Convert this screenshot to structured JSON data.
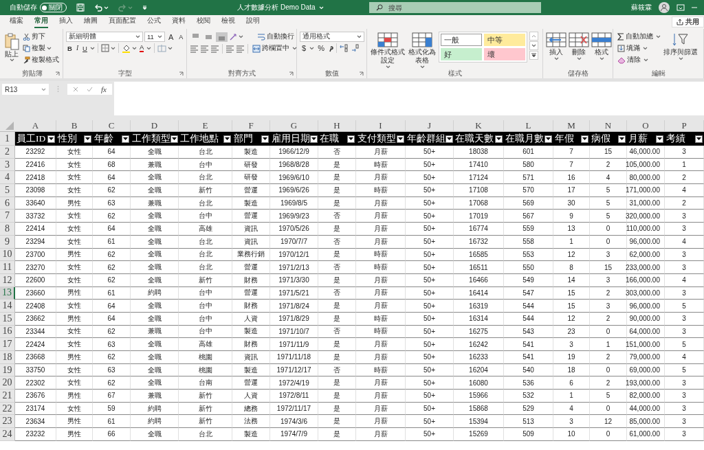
{
  "title_bar": {
    "autosave_label": "自動儲存",
    "autosave_toggle": {
      "label": "關閉",
      "on": false
    },
    "document_title": "人才數據分析 Demo Data",
    "search": {
      "placeholder": "搜尋"
    },
    "user_name": "蘇筱霖"
  },
  "ribbon_tabs": [
    {
      "label": "檔案",
      "selected": false
    },
    {
      "label": "常用",
      "selected": true
    },
    {
      "label": "插入",
      "selected": false
    },
    {
      "label": "繪圖",
      "selected": false
    },
    {
      "label": "頁面配置",
      "selected": false
    },
    {
      "label": "公式",
      "selected": false
    },
    {
      "label": "資料",
      "selected": false
    },
    {
      "label": "校閱",
      "selected": false
    },
    {
      "label": "檢視",
      "selected": false
    },
    {
      "label": "說明",
      "selected": false
    }
  ],
  "share_button": "共用",
  "clipboard": {
    "title": "剪貼簿",
    "paste": "貼上",
    "cut": "剪下",
    "copy": "複製",
    "format_painter": "複製格式"
  },
  "font": {
    "title": "字型",
    "font_name": "新細明體",
    "font_size": "11",
    "grow": "A",
    "shrink": "A",
    "bold": "B",
    "italic": "I",
    "underline": "U",
    "font_color": "A"
  },
  "alignment": {
    "title": "對齊方式",
    "vertical_align": [
      {
        "selected": false
      },
      {
        "selected": false
      },
      {
        "selected": true
      }
    ],
    "wrap_text": "自動換行",
    "merge_center": "跨欄置中"
  },
  "number": {
    "title": "數值",
    "format": "通用格式",
    "currency": "$",
    "percent": "%"
  },
  "styles": {
    "title": "樣式",
    "conditional_formatting": "條件式格式設定",
    "format_as_table": "格式化為表格",
    "cell_styles": [
      {
        "label": "一般",
        "color": "#ffffff"
      },
      {
        "label": "中等",
        "color": "#ffeb9c"
      },
      {
        "label": "好",
        "color": "#c6efce"
      },
      {
        "label": "壞",
        "color": "#ffc7ce"
      }
    ]
  },
  "cells": {
    "title": "儲存格",
    "insert": "插入",
    "delete": "刪除",
    "format": "格式"
  },
  "editing": {
    "title": "編輯",
    "autosum": "自動加總",
    "fill": "填滿",
    "clear": "清除",
    "sort_filter": "排序與篩選"
  },
  "formula_bar": {
    "name_box": "R13",
    "function_button": "fx"
  },
  "sheet": {
    "columns": [
      {
        "letter": "A",
        "header": "員工ID"
      },
      {
        "letter": "B",
        "header": "性別"
      },
      {
        "letter": "C",
        "header": "年齡"
      },
      {
        "letter": "D",
        "header": "工作類型"
      },
      {
        "letter": "E",
        "header": "工作地點"
      },
      {
        "letter": "F",
        "header": "部門"
      },
      {
        "letter": "G",
        "header": "雇用日期"
      },
      {
        "letter": "H",
        "header": "在職"
      },
      {
        "letter": "I",
        "header": "支付類型"
      },
      {
        "letter": "J",
        "header": "年齡群組"
      },
      {
        "letter": "K",
        "header": "在職天數"
      },
      {
        "letter": "L",
        "header": "在職月數"
      },
      {
        "letter": "M",
        "header": "年假"
      },
      {
        "letter": "N",
        "header": "病假"
      },
      {
        "letter": "O",
        "header": "月薪"
      },
      {
        "letter": "P",
        "header": "考績"
      }
    ],
    "header_row_number": "1",
    "rows": [
      {
        "number": "2",
        "selected": false,
        "cells": [
          "23292",
          "女性",
          "64",
          "全職",
          "台北",
          "製造",
          "1966/12/9",
          "否",
          "月薪",
          "50+",
          "18038",
          "601",
          "7",
          "15",
          "46,000.00",
          "3"
        ]
      },
      {
        "number": "3",
        "selected": false,
        "cells": [
          "22416",
          "女性",
          "68",
          "兼職",
          "台中",
          "研發",
          "1968/8/28",
          "是",
          "時薪",
          "50+",
          "17410",
          "580",
          "7",
          "2",
          "105,000.00",
          "1"
        ]
      },
      {
        "number": "4",
        "selected": false,
        "cells": [
          "22418",
          "女性",
          "64",
          "全職",
          "台北",
          "研發",
          "1969/6/10",
          "是",
          "月薪",
          "50+",
          "17124",
          "571",
          "16",
          "4",
          "80,000.00",
          "2"
        ]
      },
      {
        "number": "5",
        "selected": false,
        "cells": [
          "23098",
          "女性",
          "62",
          "全職",
          "新竹",
          "營運",
          "1969/6/26",
          "是",
          "時薪",
          "50+",
          "17108",
          "570",
          "17",
          "5",
          "171,000.00",
          "4"
        ]
      },
      {
        "number": "6",
        "selected": false,
        "cells": [
          "33640",
          "男性",
          "63",
          "兼職",
          "台北",
          "製造",
          "1969/8/5",
          "是",
          "月薪",
          "50+",
          "17068",
          "569",
          "30",
          "5",
          "31,000.00",
          "2"
        ]
      },
      {
        "number": "7",
        "selected": false,
        "cells": [
          "33732",
          "女性",
          "62",
          "全職",
          "台中",
          "營運",
          "1969/9/23",
          "否",
          "月薪",
          "50+",
          "17019",
          "567",
          "9",
          "5",
          "320,000.00",
          "3"
        ]
      },
      {
        "number": "8",
        "selected": false,
        "cells": [
          "22414",
          "女性",
          "64",
          "全職",
          "高雄",
          "資訊",
          "1970/5/26",
          "是",
          "月薪",
          "50+",
          "16774",
          "559",
          "13",
          "0",
          "110,000.00",
          "3"
        ]
      },
      {
        "number": "9",
        "selected": false,
        "cells": [
          "23294",
          "女性",
          "61",
          "全職",
          "台北",
          "資訊",
          "1970/7/7",
          "否",
          "月薪",
          "50+",
          "16732",
          "558",
          "1",
          "0",
          "96,000.00",
          "4"
        ]
      },
      {
        "number": "10",
        "selected": false,
        "cells": [
          "23700",
          "男性",
          "62",
          "全職",
          "台北",
          "業務行銷",
          "1970/12/1",
          "是",
          "時薪",
          "50+",
          "16585",
          "553",
          "12",
          "3",
          "62,000.00",
          "3"
        ]
      },
      {
        "number": "11",
        "selected": false,
        "cells": [
          "23270",
          "女性",
          "62",
          "全職",
          "台北",
          "營運",
          "1971/2/13",
          "否",
          "時薪",
          "50+",
          "16511",
          "550",
          "8",
          "15",
          "233,000.00",
          "3"
        ]
      },
      {
        "number": "12",
        "selected": false,
        "cells": [
          "22600",
          "女性",
          "62",
          "全職",
          "新竹",
          "財務",
          "1971/3/30",
          "是",
          "月薪",
          "50+",
          "16466",
          "549",
          "14",
          "3",
          "166,000.00",
          "4"
        ]
      },
      {
        "number": "13",
        "selected": true,
        "cells": [
          "23660",
          "男性",
          "61",
          "約聘",
          "台中",
          "營運",
          "1971/5/21",
          "否",
          "月薪",
          "50+",
          "16414",
          "547",
          "15",
          "2",
          "303,000.00",
          "3"
        ]
      },
      {
        "number": "14",
        "selected": false,
        "cells": [
          "22408",
          "女性",
          "64",
          "全職",
          "台中",
          "財務",
          "1971/8/24",
          "是",
          "月薪",
          "50+",
          "16319",
          "544",
          "15",
          "3",
          "96,000.00",
          "5"
        ]
      },
      {
        "number": "15",
        "selected": false,
        "cells": [
          "23662",
          "男性",
          "64",
          "全職",
          "台中",
          "人資",
          "1971/8/29",
          "是",
          "時薪",
          "50+",
          "16314",
          "544",
          "12",
          "2",
          "90,000.00",
          "3"
        ]
      },
      {
        "number": "16",
        "selected": false,
        "cells": [
          "23344",
          "女性",
          "62",
          "兼職",
          "台中",
          "製造",
          "1971/10/7",
          "否",
          "時薪",
          "50+",
          "16275",
          "543",
          "23",
          "0",
          "64,000.00",
          "3"
        ]
      },
      {
        "number": "17",
        "selected": false,
        "cells": [
          "22424",
          "女性",
          "63",
          "全職",
          "高雄",
          "財務",
          "1971/11/9",
          "是",
          "月薪",
          "50+",
          "16242",
          "541",
          "3",
          "1",
          "151,000.00",
          "5"
        ]
      },
      {
        "number": "18",
        "selected": false,
        "cells": [
          "23668",
          "男性",
          "62",
          "全職",
          "桃園",
          "資訊",
          "1971/11/18",
          "是",
          "月薪",
          "50+",
          "16233",
          "541",
          "19",
          "2",
          "79,000.00",
          "4"
        ]
      },
      {
        "number": "19",
        "selected": false,
        "cells": [
          "33750",
          "女性",
          "63",
          "全職",
          "桃園",
          "製造",
          "1971/12/17",
          "否",
          "時薪",
          "50+",
          "16204",
          "540",
          "18",
          "0",
          "69,000.00",
          "5"
        ]
      },
      {
        "number": "20",
        "selected": false,
        "cells": [
          "22302",
          "女性",
          "62",
          "全職",
          "台南",
          "營運",
          "1972/4/19",
          "是",
          "月薪",
          "50+",
          "16080",
          "536",
          "6",
          "2",
          "193,000.00",
          "3"
        ]
      },
      {
        "number": "21",
        "selected": false,
        "cells": [
          "23676",
          "男性",
          "67",
          "兼職",
          "新竹",
          "人資",
          "1972/8/11",
          "是",
          "月薪",
          "50+",
          "15966",
          "532",
          "1",
          "5",
          "82,000.00",
          "3"
        ]
      },
      {
        "number": "22",
        "selected": false,
        "cells": [
          "23174",
          "女性",
          "59",
          "約聘",
          "新竹",
          "總務",
          "1972/11/17",
          "是",
          "月薪",
          "50+",
          "15868",
          "529",
          "4",
          "0",
          "44,000.00",
          "3"
        ]
      },
      {
        "number": "23",
        "selected": false,
        "cells": [
          "23634",
          "男性",
          "61",
          "約聘",
          "新竹",
          "法務",
          "1974/3/6",
          "是",
          "月薪",
          "50+",
          "15394",
          "513",
          "3",
          "12",
          "85,000.00",
          "3"
        ]
      },
      {
        "number": "24",
        "selected": false,
        "cells": [
          "23232",
          "男性",
          "66",
          "全職",
          "台北",
          "製造",
          "1974/7/9",
          "是",
          "月薪",
          "50+",
          "15269",
          "509",
          "10",
          "0",
          "61,000.00",
          "3"
        ]
      }
    ]
  }
}
